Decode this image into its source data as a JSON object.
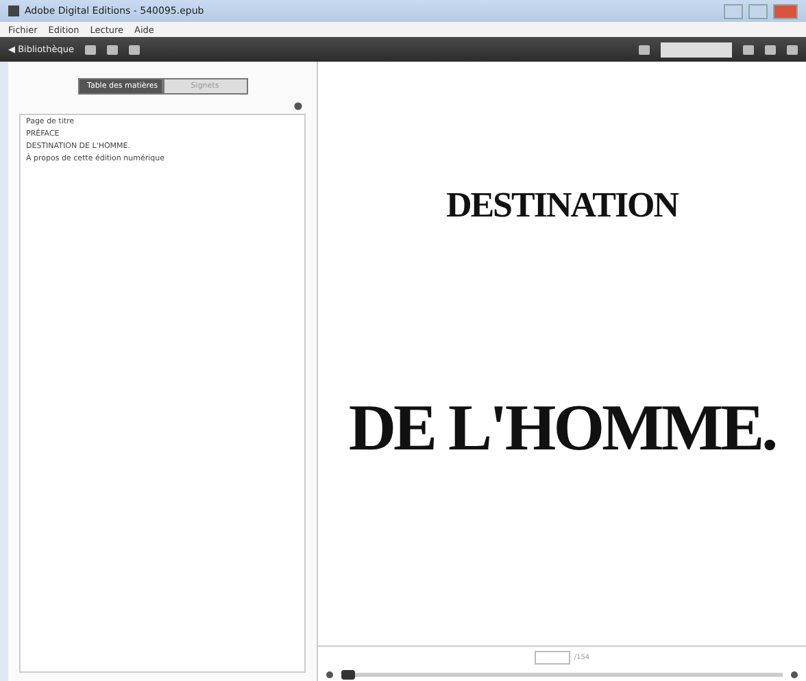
{
  "window": {
    "title": "Adobe Digital Editions - 540095.epub"
  },
  "menu": [
    "Fichier",
    "Edition",
    "Lecture",
    "Aide"
  ],
  "toolbar": {
    "library_button": "◀ Bibliothèque"
  },
  "panel_tabs": [
    {
      "label": "Table des matières",
      "selected": true
    },
    {
      "label": "Signets",
      "selected": false
    }
  ],
  "toc": [
    "Page de titre",
    "PRÉFACE",
    "DESTINATION DE L'HOMME.",
    "À propos de cette édition numérique"
  ],
  "page": {
    "lines": [
      "DESTINATION",
      "DE L'HOMME."
    ]
  },
  "footer": {
    "page_total": "/154",
    "progress": {
      "level": 0.02
    }
  }
}
